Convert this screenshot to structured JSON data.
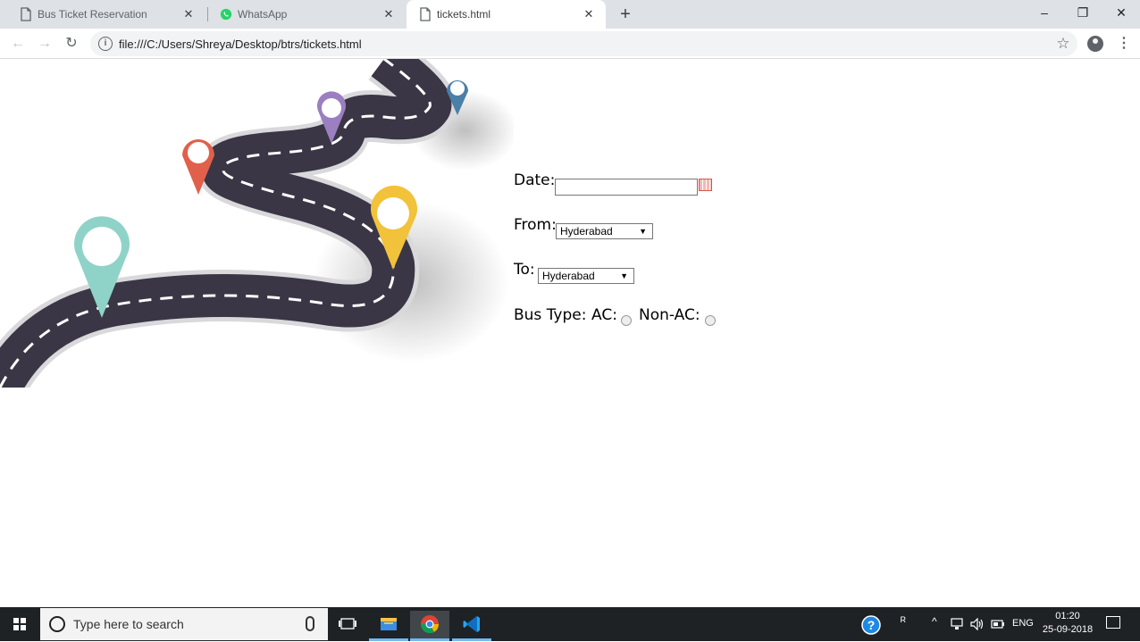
{
  "browser": {
    "tabs": [
      {
        "title": "Bus Ticket Reservation",
        "active": false,
        "icon": "page-icon"
      },
      {
        "title": "WhatsApp",
        "active": false,
        "icon": "whatsapp-icon"
      },
      {
        "title": "tickets.html",
        "active": true,
        "icon": "page-icon"
      }
    ],
    "new_tab": "+",
    "url": "file:///C:/Users/Shreya/Desktop/btrs/tickets.html",
    "window_buttons": {
      "minimize": "–",
      "restore": "❐",
      "close": "✕"
    },
    "nav": {
      "back": "←",
      "forward": "→",
      "reload": "↻"
    }
  },
  "form": {
    "date_label": "Date:",
    "date_value": "",
    "from_label": "From:",
    "from_selected": "Hyderabad",
    "to_label": "To:",
    "to_selected": "Hyderabad",
    "bus_type_label": "Bus Type:",
    "ac_label": "AC:",
    "nonac_label": "Non-AC:"
  },
  "taskbar": {
    "search_placeholder": "Type here to search",
    "language": "ENG",
    "time": "01:20",
    "date": "25-09-2018",
    "pinned": [
      "task-view-icon",
      "file-explorer-icon",
      "chrome-icon",
      "vscode-icon"
    ]
  },
  "colors": {
    "road": "#3a3645",
    "pin_teal": "#8fd3c8",
    "pin_red": "#e0604c",
    "pin_purple": "#9b7fc0",
    "pin_yellow": "#f2c23a",
    "pin_blue": "#4a7fa8",
    "taskbar": "#1f2225",
    "accent": "#76b9ed"
  }
}
